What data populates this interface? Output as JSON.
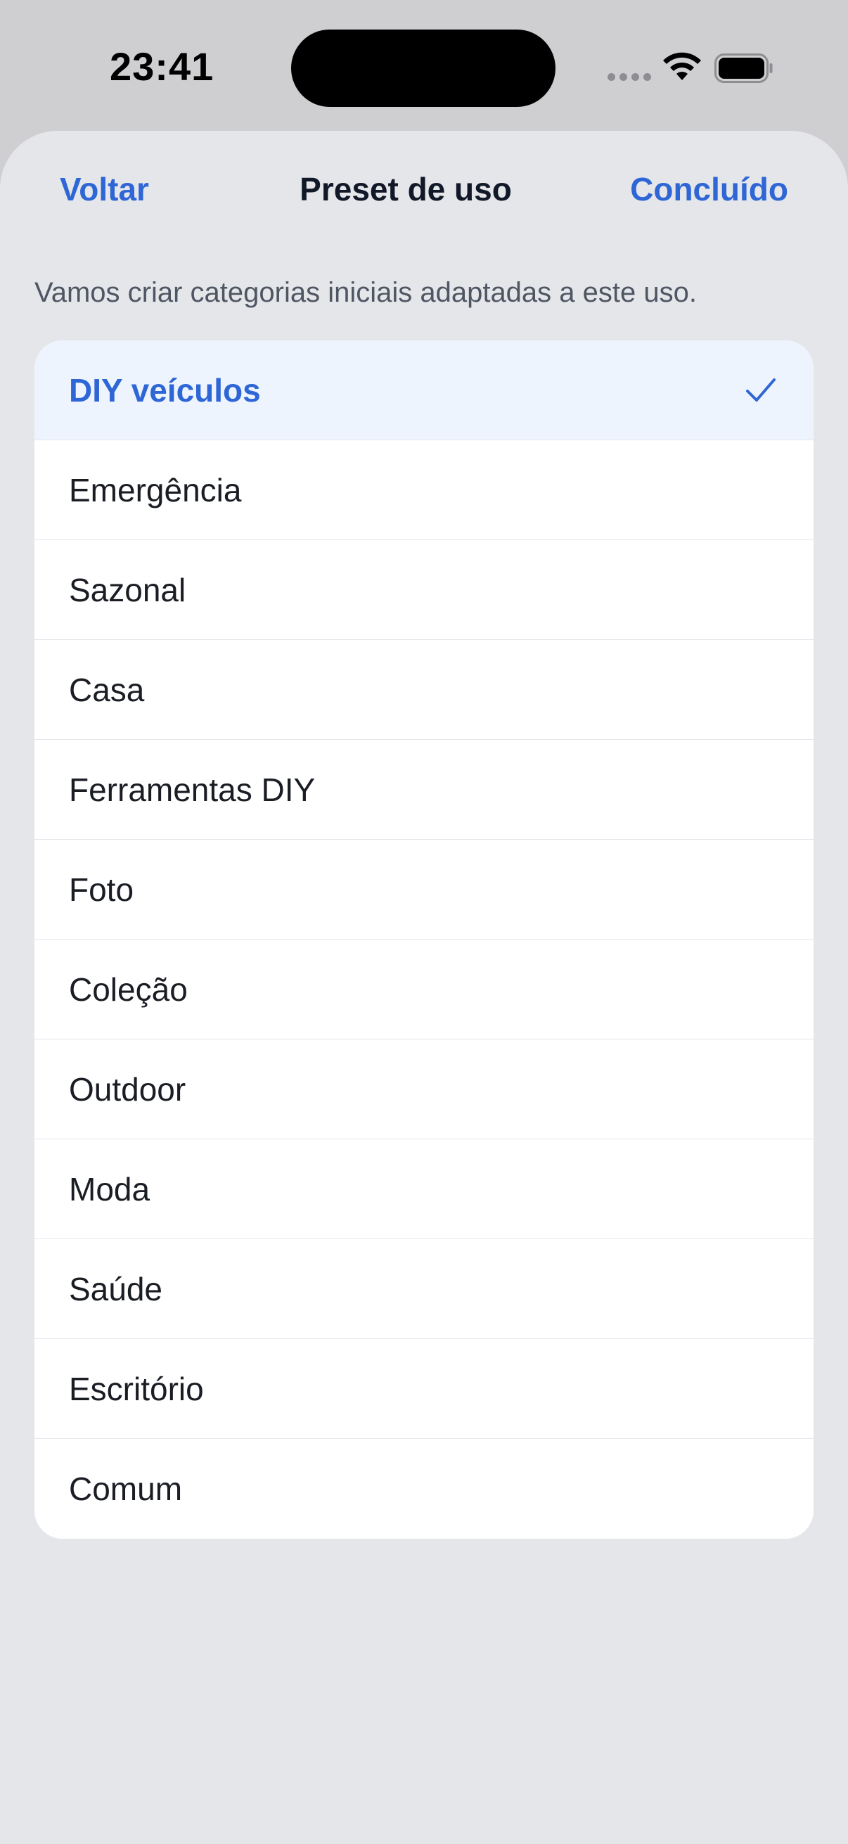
{
  "status_bar": {
    "time": "23:41"
  },
  "nav": {
    "back_label": "Voltar",
    "title": "Preset de uso",
    "done_label": "Concluído"
  },
  "subtitle": "Vamos criar categorias iniciais adaptadas a este uso.",
  "presets": [
    {
      "label": "DIY veículos",
      "selected": true
    },
    {
      "label": "Emergência",
      "selected": false
    },
    {
      "label": "Sazonal",
      "selected": false
    },
    {
      "label": "Casa",
      "selected": false
    },
    {
      "label": "Ferramentas DIY",
      "selected": false
    },
    {
      "label": "Foto",
      "selected": false
    },
    {
      "label": "Coleção",
      "selected": false
    },
    {
      "label": "Outdoor",
      "selected": false
    },
    {
      "label": "Moda",
      "selected": false
    },
    {
      "label": "Saúde",
      "selected": false
    },
    {
      "label": "Escritório",
      "selected": false
    },
    {
      "label": "Comum",
      "selected": false
    }
  ],
  "icons": {
    "selected_indicator": "checkmark-icon",
    "wifi": "wifi-icon",
    "battery": "battery-icon",
    "signal": "cellular-signal-icon"
  },
  "colors": {
    "accent": "#2f66d6",
    "selected_row_bg": "#eef4fe",
    "sheet_bg": "#e5e6ea",
    "card_bg": "#ffffff"
  }
}
